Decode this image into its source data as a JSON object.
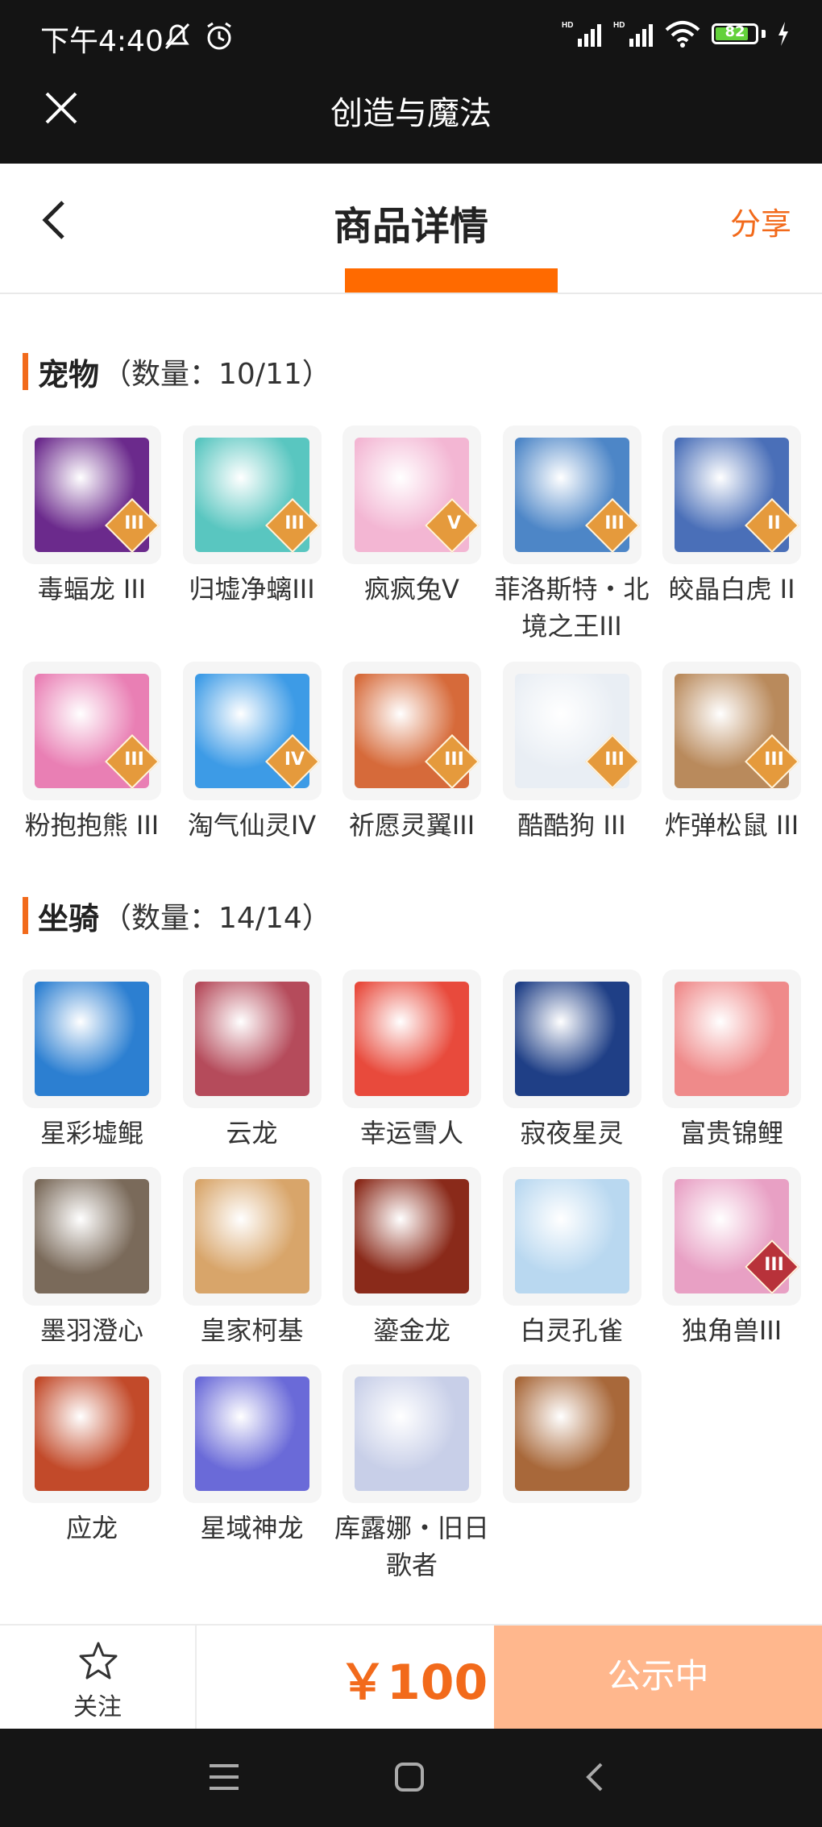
{
  "status_bar": {
    "time": "下午4:40",
    "battery": "82"
  },
  "app_bar": {
    "title": "创造与魔法"
  },
  "header": {
    "title": "商品详情",
    "share": "分享"
  },
  "pets": {
    "name": "宠物",
    "count": "（数量：10/11）",
    "items": [
      {
        "name": "毒蝠龙 III",
        "badge": "III",
        "color": "#6b2a8c"
      },
      {
        "name": "归墟净螭III",
        "badge": "III",
        "color": "#59c6c0"
      },
      {
        "name": "疯疯兔V",
        "badge": "V",
        "color": "#f3b6d3"
      },
      {
        "name": "菲洛斯特・北境之王III",
        "badge": "III",
        "color": "#4d86c7"
      },
      {
        "name": "皎晶白虎 II",
        "badge": "II",
        "color": "#4a6fb8"
      },
      {
        "name": "粉抱抱熊 III",
        "badge": "III",
        "color": "#e97fb4"
      },
      {
        "name": "淘气仙灵IV",
        "badge": "IV",
        "color": "#3d9be6"
      },
      {
        "name": "祈愿灵翼III",
        "badge": "III",
        "color": "#d66a3a"
      },
      {
        "name": "酷酷狗 III",
        "badge": "III",
        "color": "#e9eef4"
      },
      {
        "name": "炸弹松鼠 III",
        "badge": "III",
        "color": "#b98a5c"
      }
    ]
  },
  "mounts": {
    "name": "坐骑",
    "count": "（数量：14/14）",
    "items": [
      {
        "name": "星彩墟鲲",
        "badge": "",
        "color": "#2c7fd1"
      },
      {
        "name": "云龙",
        "badge": "",
        "color": "#b54b5b"
      },
      {
        "name": "幸运雪人",
        "badge": "",
        "color": "#e84a3c"
      },
      {
        "name": "寂夜星灵",
        "badge": "",
        "color": "#1f3f86"
      },
      {
        "name": "富贵锦鲤",
        "badge": "",
        "color": "#ef8a8a"
      },
      {
        "name": "墨羽澄心",
        "badge": "",
        "color": "#7a6a5a"
      },
      {
        "name": "皇家柯基",
        "badge": "",
        "color": "#d8a56a"
      },
      {
        "name": "鎏金龙",
        "badge": "",
        "color": "#8a2a1a"
      },
      {
        "name": "白灵孔雀",
        "badge": "",
        "color": "#b9d8f0"
      },
      {
        "name": "独角兽III",
        "badge": "III",
        "color": "#e8a0c4"
      },
      {
        "name": "应龙",
        "badge": "",
        "color": "#c24a2a"
      },
      {
        "name": "星域神龙",
        "badge": "",
        "color": "#6a6ad8"
      },
      {
        "name": "库露娜・旧日歌者",
        "badge": "",
        "color": "#c8cfe8"
      },
      {
        "name": "",
        "badge": "",
        "color": "#a8683a"
      }
    ]
  },
  "bottom_bar": {
    "follow": "关注",
    "price": "￥100",
    "status": "公示中"
  }
}
